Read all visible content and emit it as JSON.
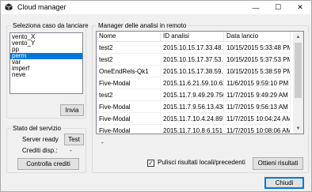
{
  "window": {
    "title": "Cloud manager",
    "min_glyph": "—",
    "max_glyph": "☐",
    "close_glyph": "✕"
  },
  "launch_group": {
    "label": "Seleziona caso da lanciare",
    "items": [
      {
        "label": "vento_X",
        "selected": false
      },
      {
        "label": "vento_Y",
        "selected": false
      },
      {
        "label": "pp",
        "selected": false
      },
      {
        "label": "perm",
        "selected": true
      },
      {
        "label": "var",
        "selected": false
      },
      {
        "label": "imperf",
        "selected": false
      },
      {
        "label": "neve",
        "selected": false
      }
    ],
    "send_label": "Invia"
  },
  "service_group": {
    "label": "Stato del servizio",
    "status_text": "Server ready",
    "test_label": "Test",
    "credits_label": "Crediti disp.:",
    "credits_value": "-",
    "check_credits_label": "Controlla crediti"
  },
  "manager_group": {
    "label": "Manager delle analisi in remoto",
    "columns": [
      "Nome",
      "ID analisi",
      "Data lancio"
    ],
    "rows": [
      [
        "test2",
        "2015.10.15.17.33.48....",
        "10/15/2015 5:33:48 PM"
      ],
      [
        "test2",
        "2015.10.15.17.37.53....",
        "10/15/2015 5:37:53 PM"
      ],
      [
        "OneEndRels-Qk1",
        "2015.10.15.17.38.59....",
        "10/15/2015 5:38:59 PM"
      ],
      [
        "Five-Modal",
        "2015.11.6.21.59.10.624",
        "11/6/2015 9:59:10 PM"
      ],
      [
        "test2",
        "2015.11.7.9.49.29.750",
        "11/7/2015 9:49:29 AM"
      ],
      [
        "Five-Modal",
        "2015.11.7.9.56.13.438",
        "11/7/2015 9:56:13 AM"
      ],
      [
        "Five-Modal",
        "2015.11.7.10.4.24.897",
        "11/7/2015 10:04:24 AM"
      ],
      [
        "Five-Modal",
        "2015.11.7.10.8.6.151",
        "11/7/2015 10:08:06 AM"
      ]
    ],
    "status_dash": "-",
    "clean_checkbox_checked": true,
    "clean_checkbox_label": "Pulisci risultati locali/precedenti",
    "get_results_label": "Ottieni risultati",
    "scroll_up_glyph": "▲",
    "scroll_down_glyph": "▼"
  },
  "footer": {
    "close_label": "Chiudi"
  },
  "colors": {
    "selection": "#0078d7",
    "window_bg": "#f0f0f0"
  }
}
